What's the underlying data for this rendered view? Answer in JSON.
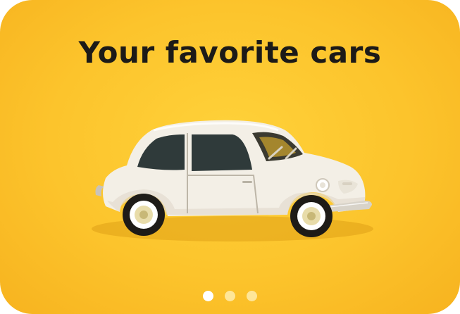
{
  "carousel": {
    "title": "Your favorite cars",
    "image_subject": "white-vintage-car",
    "background_color": "#fcc42c",
    "title_color": "#1c1a18",
    "pagination": {
      "total": 3,
      "active_index": 0
    }
  }
}
